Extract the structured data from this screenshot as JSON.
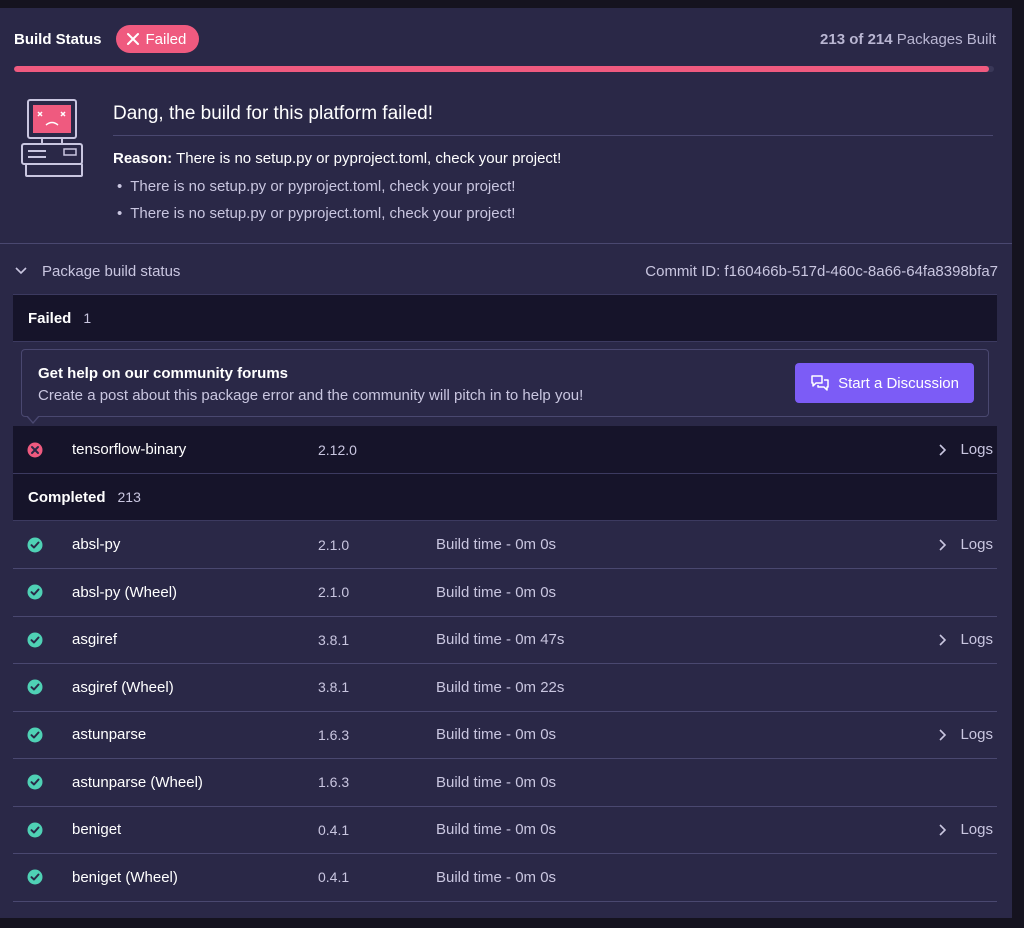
{
  "header": {
    "title": "Build Status",
    "badge": "Failed",
    "built_count": "213 of 214",
    "built_suffix": "Packages Built",
    "progress_percent": 99.5
  },
  "failure": {
    "title": "Dang, the build for this platform failed!",
    "reason_label": "Reason:",
    "reason_text": "There is no setup.py or pyproject.toml, check your project!",
    "details": [
      "There is no setup.py or pyproject.toml, check your project!",
      "There is no setup.py or pyproject.toml, check your project!"
    ]
  },
  "package_status": {
    "label": "Package build status",
    "commit": "Commit ID: f160466b-517d-460c-8a66-64fa8398bfa7"
  },
  "failed_group": {
    "title": "Failed",
    "count": "1",
    "help_title": "Get help on our community forums",
    "help_desc": "Create a post about this package error and the community will pitch in to help you!",
    "discuss_label": "Start a Discussion",
    "packages": [
      {
        "name": "tensorflow-binary",
        "version": "2.12.0",
        "logs": "Logs"
      }
    ]
  },
  "completed_group": {
    "title": "Completed",
    "count": "213",
    "packages": [
      {
        "name": "absl-py",
        "version": "2.1.0",
        "time": "Build time - 0m 0s",
        "logs": "Logs"
      },
      {
        "name": "absl-py (Wheel)",
        "version": "2.1.0",
        "time": "Build time - 0m 0s"
      },
      {
        "name": "asgiref",
        "version": "3.8.1",
        "time": "Build time - 0m 47s",
        "logs": "Logs"
      },
      {
        "name": "asgiref (Wheel)",
        "version": "3.8.1",
        "time": "Build time - 0m 22s"
      },
      {
        "name": "astunparse",
        "version": "1.6.3",
        "time": "Build time - 0m 0s",
        "logs": "Logs"
      },
      {
        "name": "astunparse (Wheel)",
        "version": "1.6.3",
        "time": "Build time - 0m 0s"
      },
      {
        "name": "beniget",
        "version": "0.4.1",
        "time": "Build time - 0m 0s",
        "logs": "Logs"
      },
      {
        "name": "beniget (Wheel)",
        "version": "0.4.1",
        "time": "Build time - 0m 0s"
      }
    ]
  },
  "colors": {
    "accent_failed": "#ef5a7f",
    "accent_success": "#4fd1b5",
    "button": "#7c5cf6"
  }
}
